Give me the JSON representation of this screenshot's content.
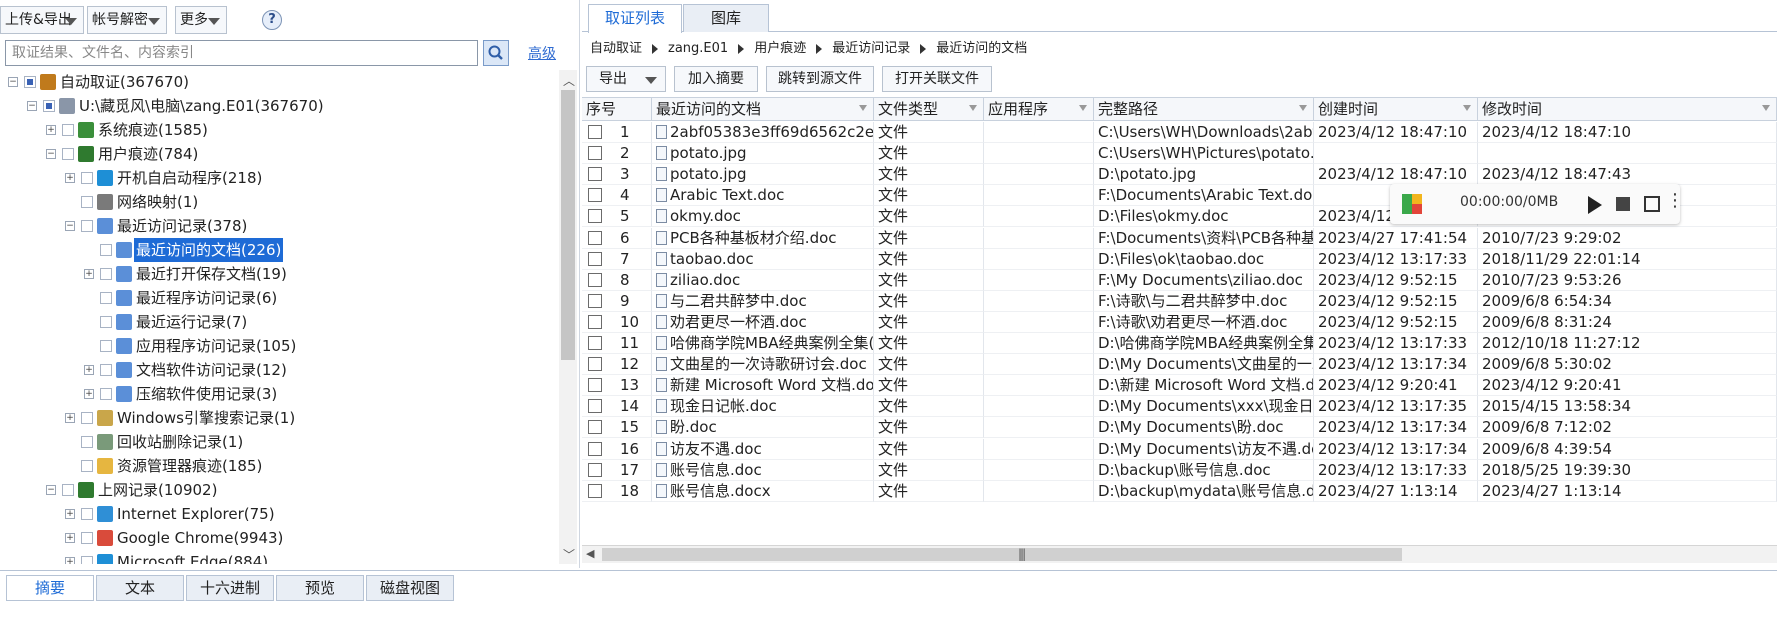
{
  "toolbar": {
    "upload_export": "上传&导出",
    "account_decrypt": "帐号解密",
    "more": "更多",
    "help": "?"
  },
  "search": {
    "placeholder": "取证结果、文件名、内容索引",
    "advanced": "高级"
  },
  "tree": [
    {
      "label": "自动取证(367670)",
      "level": 0,
      "exp": "-",
      "chk": "part",
      "icon": "forensics-icon",
      "color": "#c07a1c"
    },
    {
      "label": "U:\\藏觅风\\电脑\\zang.E01(367670)",
      "level": 1,
      "exp": "-",
      "chk": "part",
      "icon": "disk-image-icon",
      "color": "#8a96a8"
    },
    {
      "label": "系统痕迹(1585)",
      "level": 2,
      "exp": "+",
      "chk": "",
      "icon": "system-trace-icon",
      "color": "#3b8f3b"
    },
    {
      "label": "用户痕迹(784)",
      "level": 2,
      "exp": "-",
      "chk": "",
      "icon": "user-trace-icon",
      "color": "#2f7a2f"
    },
    {
      "label": "开机自启动程序(218)",
      "level": 3,
      "exp": "+",
      "chk": "",
      "icon": "startup-icon",
      "color": "#1e8fd6"
    },
    {
      "label": "网络映射(1)",
      "level": 3,
      "exp": "",
      "chk": "",
      "icon": "network-map-icon",
      "color": "#7a7a7a"
    },
    {
      "label": "最近访问记录(378)",
      "level": 3,
      "exp": "-",
      "chk": "",
      "icon": "recent-access-icon",
      "color": "#5b8fd8"
    },
    {
      "label": "最近访问的文档(226)",
      "level": 4,
      "exp": "",
      "chk": "",
      "icon": "recent-docs-icon",
      "color": "#5b8fd8",
      "selected": true
    },
    {
      "label": "最近打开保存文档(19)",
      "level": 4,
      "exp": "+",
      "chk": "",
      "icon": "open-save-icon",
      "color": "#5b8fd8"
    },
    {
      "label": "最近程序访问记录(6)",
      "level": 4,
      "exp": "",
      "chk": "",
      "icon": "program-access-icon",
      "color": "#5b8fd8"
    },
    {
      "label": "最近运行记录(7)",
      "level": 4,
      "exp": "",
      "chk": "",
      "icon": "run-history-icon",
      "color": "#5b8fd8"
    },
    {
      "label": "应用程序访问记录(105)",
      "level": 4,
      "exp": "",
      "chk": "",
      "icon": "app-access-icon",
      "color": "#5b8fd8"
    },
    {
      "label": "文档软件访问记录(12)",
      "level": 4,
      "exp": "+",
      "chk": "",
      "icon": "doc-software-icon",
      "color": "#5b8fd8"
    },
    {
      "label": "压缩软件使用记录(3)",
      "level": 4,
      "exp": "+",
      "chk": "",
      "icon": "archive-software-icon",
      "color": "#5b8fd8"
    },
    {
      "label": "Windows引擎搜索记录(1)",
      "level": 3,
      "exp": "+",
      "chk": "",
      "icon": "windows-search-icon",
      "color": "#c9a64a"
    },
    {
      "label": "回收站删除记录(1)",
      "level": 3,
      "exp": "",
      "chk": "",
      "icon": "recycle-bin-icon",
      "color": "#7a9a7a"
    },
    {
      "label": "资源管理器痕迹(185)",
      "level": 3,
      "exp": "",
      "chk": "",
      "icon": "folder-icon",
      "color": "#e6b640"
    },
    {
      "label": "上网记录(10902)",
      "level": 2,
      "exp": "-",
      "chk": "",
      "icon": "internet-icon",
      "color": "#2f7a2f"
    },
    {
      "label": "Internet Explorer(75)",
      "level": 3,
      "exp": "+",
      "chk": "",
      "icon": "ie-icon",
      "color": "#2f8fd6"
    },
    {
      "label": "Google Chrome(9943)",
      "level": 3,
      "exp": "+",
      "chk": "",
      "icon": "chrome-icon",
      "color": "#d94b3b"
    },
    {
      "label": "Microsoft Edge(884)",
      "level": 3,
      "exp": "+",
      "chk": "",
      "icon": "edge-icon",
      "color": "#1e8fd6"
    }
  ],
  "tabs": [
    "取证列表",
    "图库"
  ],
  "breadcrumb": [
    "自动取证",
    "zang.E01",
    "用户痕迹",
    "最近访问记录",
    "最近访问的文档"
  ],
  "actions": {
    "export": "导出",
    "add_summary": "加入摘要",
    "jump_source": "跳转到源文件",
    "open_related": "打开关联文件"
  },
  "columns": [
    "序号",
    "最近访问的文档",
    "文件类型",
    "应用程序",
    "完整路径",
    "创建时间",
    "修改时间"
  ],
  "rows": [
    [
      "1",
      "2abf05383e3ff69d6562c2eb...",
      "文件",
      "",
      "C:\\Users\\WH\\Downloads\\2abf...",
      "2023/4/12 18:47:10",
      "2023/4/12 18:47:10"
    ],
    [
      "2",
      "potato.jpg",
      "文件",
      "",
      "C:\\Users\\WH\\Pictures\\potato.jpg",
      "",
      ""
    ],
    [
      "3",
      "potato.jpg",
      "文件",
      "",
      "D:\\potato.jpg",
      "2023/4/12 18:47:10",
      "2023/4/12 18:47:43"
    ],
    [
      "4",
      "Arabic Text.doc",
      "文件",
      "",
      "F:\\Documents\\Arabic Text.doc",
      "",
      "47:34"
    ],
    [
      "5",
      "okmy.doc",
      "文件",
      "",
      "D:\\Files\\okmy.doc",
      "2023/4/12 13:17:33",
      "2018/11/29 21:55:38"
    ],
    [
      "6",
      "PCB各种基板材介绍.doc",
      "文件",
      "",
      "F:\\Documents\\资料\\PCB各种基板...",
      "2023/4/27 17:41:54",
      "2010/7/23 9:29:02"
    ],
    [
      "7",
      "taobao.doc",
      "文件",
      "",
      "D:\\Files\\ok\\taobao.doc",
      "2023/4/12 13:17:33",
      "2018/11/29 22:01:14"
    ],
    [
      "8",
      "ziliao.doc",
      "文件",
      "",
      "F:\\My Documents\\ziliao.doc",
      "2023/4/12 9:52:15",
      "2010/7/23 9:53:26"
    ],
    [
      "9",
      "与二君共醉梦中.doc",
      "文件",
      "",
      "F:\\诗歌\\与二君共醉梦中.doc",
      "2023/4/12 9:52:15",
      "2009/6/8 6:54:34"
    ],
    [
      "10",
      "劝君更尽一杯酒.doc",
      "文件",
      "",
      "F:\\诗歌\\劝君更尽一杯酒.doc",
      "2023/4/12 9:52:15",
      "2009/6/8 8:31:24"
    ],
    [
      "11",
      "哈佛商学院MBA经典案例全集(...",
      "文件",
      "",
      "D:\\哈佛商学院MBA经典案例全集(...",
      "2023/4/12 13:17:33",
      "2012/10/18 11:27:12"
    ],
    [
      "12",
      "文曲星的一次诗歌研讨会.doc",
      "文件",
      "",
      "D:\\My Documents\\文曲星的一次...",
      "2023/4/12 13:17:34",
      "2009/6/8 5:30:02"
    ],
    [
      "13",
      "新建 Microsoft Word 文档.docx",
      "文件",
      "",
      "D:\\新建 Microsoft Word 文档.docx",
      "2023/4/12 9:20:41",
      "2023/4/12 9:20:41"
    ],
    [
      "14",
      "现金日记帐.doc",
      "文件",
      "",
      "D:\\My Documents\\xxx\\现金日记...",
      "2023/4/12 13:17:35",
      "2015/4/15 13:58:34"
    ],
    [
      "15",
      "盼.doc",
      "文件",
      "",
      "D:\\My Documents\\盼.doc",
      "2023/4/12 13:17:34",
      "2009/6/8 7:12:02"
    ],
    [
      "16",
      "访友不遇.doc",
      "文件",
      "",
      "D:\\My Documents\\访友不遇.doc",
      "2023/4/12 13:17:34",
      "2009/6/8 4:39:54"
    ],
    [
      "17",
      "账号信息.doc",
      "文件",
      "",
      "D:\\backup\\账号信息.doc",
      "2023/4/12 13:17:33",
      "2018/5/25 19:39:30"
    ],
    [
      "18",
      "账号信息.docx",
      "文件",
      "",
      "D:\\backup\\mydata\\账号信息.docx",
      "2023/4/27 1:13:14",
      "2023/4/27 1:13:14"
    ]
  ],
  "media": {
    "time": "00:00:00/0MB"
  },
  "bottom_tabs": [
    "摘要",
    "文本",
    "十六进制",
    "预览",
    "磁盘视图"
  ],
  "colors": {
    "accent": "#1e6bd6",
    "selected_bg": "#1e6bd6"
  }
}
